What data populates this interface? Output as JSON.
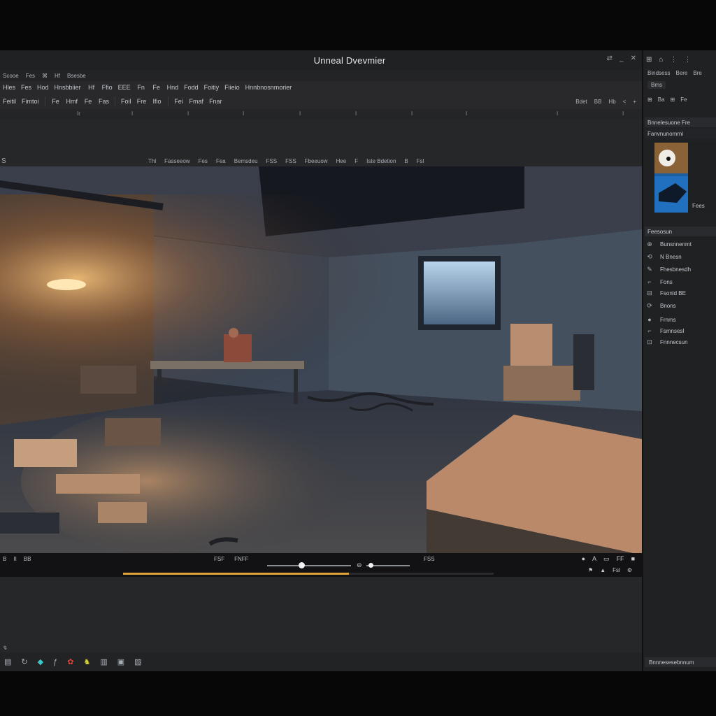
{
  "window": {
    "title": "Unneal Dvevmier",
    "controls": [
      "⇄",
      "_",
      "✕"
    ]
  },
  "menu": [
    "Scooe",
    "Fes",
    "⌘",
    "Hf",
    "Bsesbe"
  ],
  "toolbar": {
    "row1": [
      "Hles",
      "Fes",
      "Hod",
      "Hnsbbiier",
      "Hf",
      "Ffio",
      "EEE",
      "Fn",
      "Fe",
      "Hnd",
      "Fodd",
      "Foitiy",
      "Fiieio",
      "Hnnbnosnmorier"
    ],
    "row2": [
      "Feitil",
      "Fimtoi",
      "Fe",
      "Hmf",
      "Fe",
      "Fas",
      "Foil",
      "Fre",
      "Ifio",
      "Fei",
      "Fmaf",
      "Fnar"
    ],
    "right": [
      "Bdet",
      "BB",
      "Hb",
      "<",
      "+"
    ]
  },
  "ruler": [
    "Ir",
    "I",
    "I",
    "I",
    "I",
    "I",
    "I",
    "I",
    "I",
    "I"
  ],
  "viewport_header": {
    "left_icon": "S",
    "labels": [
      "Thl",
      "Fasseeow",
      "Fes",
      "Fea",
      "Bemsdeu",
      "FSS",
      "FSS",
      "Fbeeuow",
      "Hee",
      "F",
      "Iste Bdetion",
      "B",
      "Fsl"
    ]
  },
  "timeline": {
    "left": [
      "B",
      "II",
      "BB"
    ],
    "mid": [
      "FSF",
      "FNFF"
    ],
    "frame": "FSS",
    "right": [
      "●",
      "A",
      "▭",
      "FF",
      "■"
    ],
    "bottom_right": [
      "⚑",
      "▲",
      "Fsl",
      "⚙"
    ],
    "progress": 0.61,
    "slider_value": 0.41,
    "slider2_value": 0.1
  },
  "lower_icon": "↯",
  "statusbar_icons": [
    {
      "glyph": "▤",
      "color": "#aab0b8"
    },
    {
      "glyph": "↻",
      "color": "#aab0b8"
    },
    {
      "glyph": "◆",
      "color": "#3ec8c8"
    },
    {
      "glyph": "ƒ",
      "color": "#aab0b8"
    },
    {
      "glyph": "✿",
      "color": "#e0443a"
    },
    {
      "glyph": "♞",
      "color": "#d8d23a"
    },
    {
      "glyph": "▥",
      "color": "#aab0b8"
    },
    {
      "glyph": "▣",
      "color": "#aab0b8"
    },
    {
      "glyph": "▨",
      "color": "#aab0b8"
    }
  ],
  "right_panel": {
    "top_icons": [
      "⊞",
      "⌂",
      "⋮",
      "⋮"
    ],
    "row1": [
      "Bindsess",
      "Bere",
      "Bre"
    ],
    "row2_btn": "Bms",
    "row3": [
      "⊞",
      "Ba",
      "⊞",
      "Fe"
    ],
    "details_header": "Bnnelesuone  Fre",
    "details_sub": "Fanvnunomrni",
    "preview_label": "Fees",
    "section2": "Feesosun",
    "outliner": [
      "Bunsnnenmt",
      "N Bnesn",
      "Fhesbnesdh",
      "Fons",
      "Fsonld BE",
      "Bnons",
      "Frnms",
      "Fsmnsesl",
      "Fnnnecsun"
    ],
    "footer": "Bnnnesesebnnum"
  }
}
